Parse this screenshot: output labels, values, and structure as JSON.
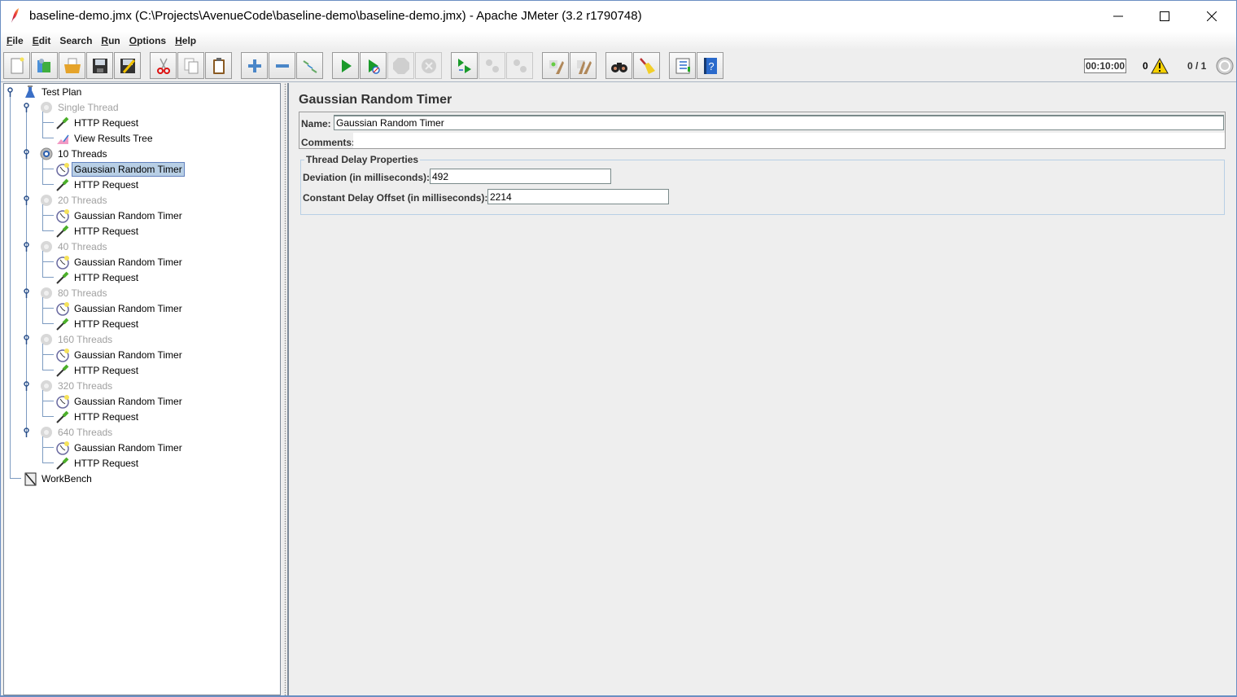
{
  "window": {
    "title": "baseline-demo.jmx (C:\\Projects\\AvenueCode\\baseline-demo\\baseline-demo.jmx) - Apache JMeter (3.2 r1790748)",
    "controls": {
      "minimize": "—",
      "maximize": "☐",
      "close": "✕"
    }
  },
  "menubar": {
    "items": [
      {
        "mnemonic": "F",
        "rest": "ile"
      },
      {
        "mnemonic": "E",
        "rest": "dit"
      },
      {
        "mnemonic": "",
        "rest": "Search"
      },
      {
        "mnemonic": "R",
        "rest": "un"
      },
      {
        "mnemonic": "O",
        "rest": "ptions"
      },
      {
        "mnemonic": "H",
        "rest": "elp"
      }
    ]
  },
  "toolbar": {
    "buttons": [
      {
        "name": "new-icon",
        "enabled": true
      },
      {
        "name": "templates-icon",
        "enabled": true
      },
      {
        "name": "open-icon",
        "enabled": true
      },
      {
        "name": "save-icon",
        "enabled": true
      },
      {
        "name": "save-as-icon",
        "enabled": true
      },
      {
        "name": "cut-icon",
        "enabled": true
      },
      {
        "name": "copy-icon",
        "enabled": true
      },
      {
        "name": "paste-icon",
        "enabled": true
      },
      {
        "name": "expand-all-icon",
        "enabled": true
      },
      {
        "name": "collapse-all-icon",
        "enabled": true
      },
      {
        "name": "toggle-icon",
        "enabled": true
      },
      {
        "name": "start-icon",
        "enabled": true
      },
      {
        "name": "start-no-pauses-icon",
        "enabled": true
      },
      {
        "name": "stop-icon",
        "enabled": false
      },
      {
        "name": "shutdown-icon",
        "enabled": false
      },
      {
        "name": "remote-start-all-icon",
        "enabled": true
      },
      {
        "name": "remote-stop-all-icon",
        "enabled": false
      },
      {
        "name": "remote-shutdown-all-icon",
        "enabled": false
      },
      {
        "name": "clear-icon",
        "enabled": true
      },
      {
        "name": "clear-all-icon",
        "enabled": true
      },
      {
        "name": "search-icon",
        "enabled": true
      },
      {
        "name": "reset-search-icon",
        "enabled": true
      },
      {
        "name": "function-helper-icon",
        "enabled": true
      },
      {
        "name": "help-icon",
        "enabled": true
      }
    ],
    "timer": "00:10:00",
    "error_count": "0",
    "thread_count": "0 / 1"
  },
  "tree": {
    "nodes": [
      {
        "label": "Test Plan",
        "type": "testplan",
        "level": 0,
        "disabled": false,
        "selected": false,
        "expandable": true
      },
      {
        "label": "Single Thread",
        "type": "threadgroup",
        "level": 1,
        "disabled": true,
        "selected": false,
        "expandable": true
      },
      {
        "label": "HTTP Request",
        "type": "sampler",
        "level": 2,
        "disabled": false,
        "selected": false
      },
      {
        "label": "View Results Tree",
        "type": "listener",
        "level": 2,
        "disabled": false,
        "selected": false
      },
      {
        "label": "10 Threads",
        "type": "threadgroup-active",
        "level": 1,
        "disabled": false,
        "selected": false,
        "expandable": true
      },
      {
        "label": "Gaussian Random Timer",
        "type": "timer",
        "level": 2,
        "disabled": false,
        "selected": true
      },
      {
        "label": "HTTP Request",
        "type": "sampler",
        "level": 2,
        "disabled": false,
        "selected": false
      },
      {
        "label": "20 Threads",
        "type": "threadgroup",
        "level": 1,
        "disabled": true,
        "selected": false,
        "expandable": true
      },
      {
        "label": "Gaussian Random Timer",
        "type": "timer",
        "level": 2,
        "disabled": false,
        "selected": false
      },
      {
        "label": "HTTP Request",
        "type": "sampler",
        "level": 2,
        "disabled": false,
        "selected": false
      },
      {
        "label": "40 Threads",
        "type": "threadgroup",
        "level": 1,
        "disabled": true,
        "selected": false,
        "expandable": true
      },
      {
        "label": "Gaussian Random Timer",
        "type": "timer",
        "level": 2,
        "disabled": false,
        "selected": false
      },
      {
        "label": "HTTP Request",
        "type": "sampler",
        "level": 2,
        "disabled": false,
        "selected": false
      },
      {
        "label": "80 Threads",
        "type": "threadgroup",
        "level": 1,
        "disabled": true,
        "selected": false,
        "expandable": true
      },
      {
        "label": "Gaussian Random Timer",
        "type": "timer",
        "level": 2,
        "disabled": false,
        "selected": false
      },
      {
        "label": "HTTP Request",
        "type": "sampler",
        "level": 2,
        "disabled": false,
        "selected": false
      },
      {
        "label": "160 Threads",
        "type": "threadgroup",
        "level": 1,
        "disabled": true,
        "selected": false,
        "expandable": true
      },
      {
        "label": "Gaussian Random Timer",
        "type": "timer",
        "level": 2,
        "disabled": false,
        "selected": false
      },
      {
        "label": "HTTP Request",
        "type": "sampler",
        "level": 2,
        "disabled": false,
        "selected": false
      },
      {
        "label": "320 Threads",
        "type": "threadgroup",
        "level": 1,
        "disabled": true,
        "selected": false,
        "expandable": true
      },
      {
        "label": "Gaussian Random Timer",
        "type": "timer",
        "level": 2,
        "disabled": false,
        "selected": false
      },
      {
        "label": "HTTP Request",
        "type": "sampler",
        "level": 2,
        "disabled": false,
        "selected": false
      },
      {
        "label": "640 Threads",
        "type": "threadgroup",
        "level": 1,
        "disabled": true,
        "selected": false,
        "expandable": true
      },
      {
        "label": "Gaussian Random Timer",
        "type": "timer",
        "level": 2,
        "disabled": false,
        "selected": false
      },
      {
        "label": "HTTP Request",
        "type": "sampler",
        "level": 2,
        "disabled": false,
        "selected": false
      },
      {
        "label": "WorkBench",
        "type": "workbench",
        "level": 0,
        "disabled": false,
        "selected": false
      }
    ]
  },
  "editor": {
    "title": "Gaussian Random Timer",
    "name_label": "Name:",
    "name_value": "Gaussian Random Timer",
    "comments_label": "Comments:",
    "comments_value": "",
    "group_title": "Thread Delay Properties",
    "deviation_label": "Deviation (in milliseconds):",
    "deviation_value": "492",
    "offset_label": "Constant Delay Offset (in milliseconds):",
    "offset_value": "2214"
  }
}
